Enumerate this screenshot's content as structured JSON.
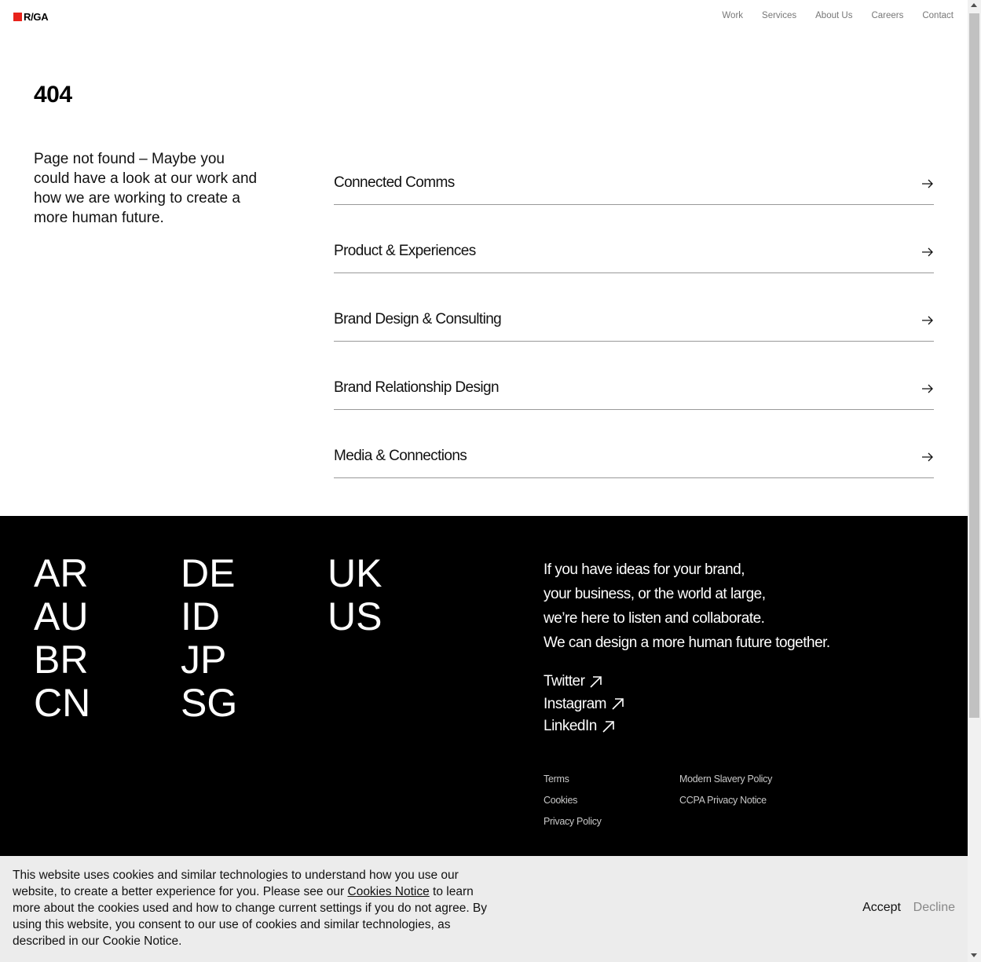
{
  "header": {
    "logo_text": "R/GA",
    "nav": [
      "Work",
      "Services",
      "About Us",
      "Careers",
      "Contact"
    ]
  },
  "main": {
    "error_code": "404",
    "message": "Page not found – Maybe you could have a look at our work and how we are working to create a more human future.",
    "links": [
      "Connected Comms",
      "Product & Experiences",
      "Brand Design & Consulting",
      "Brand Relationship Design",
      "Media & Connections"
    ]
  },
  "footer": {
    "countries_col1": [
      "AR",
      "AU",
      "BR",
      "CN"
    ],
    "countries_col2": [
      "DE",
      "ID",
      "JP",
      "SG"
    ],
    "countries_col3": [
      "UK",
      "US"
    ],
    "tagline": [
      "If you have ideas for your brand,",
      "your business, or the world at large,",
      "we’re here to listen and collaborate.",
      "We can design a more human future together."
    ],
    "socials": [
      "Twitter",
      "Instagram",
      "LinkedIn"
    ],
    "legal_col1": [
      "Terms",
      "Cookies",
      "Privacy Policy"
    ],
    "legal_col2": [
      "Modern Slavery Policy",
      "CCPA Privacy Notice"
    ]
  },
  "cookie": {
    "text_before": "This website uses cookies and similar technologies to understand how you use our website, to create a better experience for you. Please see our ",
    "link": "Cookies Notice",
    "text_after": " to learn more about the cookies used and how to change current settings if you do not agree. By using this website, you consent to our use of cookies and similar technologies, as described in our Cookie Notice.",
    "accept": "Accept",
    "decline": "Decline"
  },
  "colors": {
    "brand_red": "#e8231b",
    "footer_bg": "#000000",
    "banner_bg": "#ececec"
  },
  "icons": {
    "link_arrow": "arrow-right-icon",
    "external": "arrow-up-right-icon",
    "logo_mark": "red-square-logo-icon"
  }
}
